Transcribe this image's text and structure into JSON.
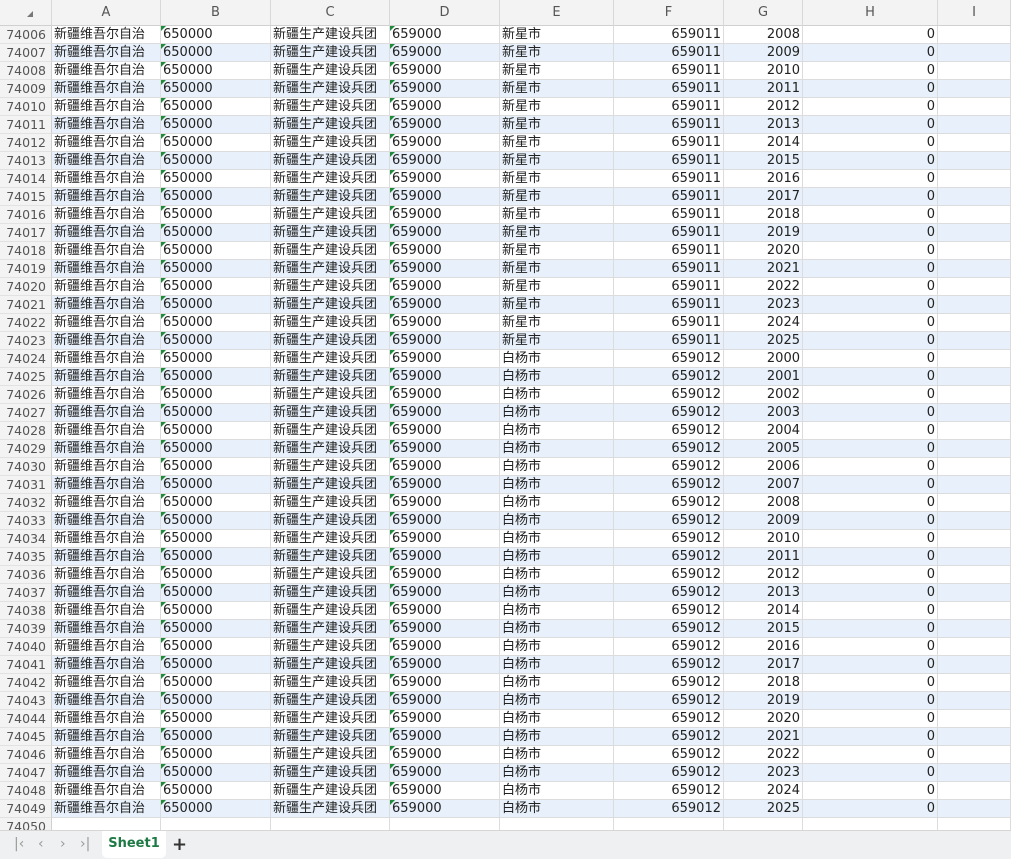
{
  "columns": [
    "A",
    "B",
    "C",
    "D",
    "E",
    "F",
    "G",
    "H",
    "I"
  ],
  "rows": [
    [
      "74006",
      "新疆维吾尔自治",
      "650000",
      "新疆生产建设兵团",
      "659000",
      "新星市",
      "659011",
      "2008",
      "0"
    ],
    [
      "74007",
      "新疆维吾尔自治",
      "650000",
      "新疆生产建设兵团",
      "659000",
      "新星市",
      "659011",
      "2009",
      "0"
    ],
    [
      "74008",
      "新疆维吾尔自治",
      "650000",
      "新疆生产建设兵团",
      "659000",
      "新星市",
      "659011",
      "2010",
      "0"
    ],
    [
      "74009",
      "新疆维吾尔自治",
      "650000",
      "新疆生产建设兵团",
      "659000",
      "新星市",
      "659011",
      "2011",
      "0"
    ],
    [
      "74010",
      "新疆维吾尔自治",
      "650000",
      "新疆生产建设兵团",
      "659000",
      "新星市",
      "659011",
      "2012",
      "0"
    ],
    [
      "74011",
      "新疆维吾尔自治",
      "650000",
      "新疆生产建设兵团",
      "659000",
      "新星市",
      "659011",
      "2013",
      "0"
    ],
    [
      "74012",
      "新疆维吾尔自治",
      "650000",
      "新疆生产建设兵团",
      "659000",
      "新星市",
      "659011",
      "2014",
      "0"
    ],
    [
      "74013",
      "新疆维吾尔自治",
      "650000",
      "新疆生产建设兵团",
      "659000",
      "新星市",
      "659011",
      "2015",
      "0"
    ],
    [
      "74014",
      "新疆维吾尔自治",
      "650000",
      "新疆生产建设兵团",
      "659000",
      "新星市",
      "659011",
      "2016",
      "0"
    ],
    [
      "74015",
      "新疆维吾尔自治",
      "650000",
      "新疆生产建设兵团",
      "659000",
      "新星市",
      "659011",
      "2017",
      "0"
    ],
    [
      "74016",
      "新疆维吾尔自治",
      "650000",
      "新疆生产建设兵团",
      "659000",
      "新星市",
      "659011",
      "2018",
      "0"
    ],
    [
      "74017",
      "新疆维吾尔自治",
      "650000",
      "新疆生产建设兵团",
      "659000",
      "新星市",
      "659011",
      "2019",
      "0"
    ],
    [
      "74018",
      "新疆维吾尔自治",
      "650000",
      "新疆生产建设兵团",
      "659000",
      "新星市",
      "659011",
      "2020",
      "0"
    ],
    [
      "74019",
      "新疆维吾尔自治",
      "650000",
      "新疆生产建设兵团",
      "659000",
      "新星市",
      "659011",
      "2021",
      "0"
    ],
    [
      "74020",
      "新疆维吾尔自治",
      "650000",
      "新疆生产建设兵团",
      "659000",
      "新星市",
      "659011",
      "2022",
      "0"
    ],
    [
      "74021",
      "新疆维吾尔自治",
      "650000",
      "新疆生产建设兵团",
      "659000",
      "新星市",
      "659011",
      "2023",
      "0"
    ],
    [
      "74022",
      "新疆维吾尔自治",
      "650000",
      "新疆生产建设兵团",
      "659000",
      "新星市",
      "659011",
      "2024",
      "0"
    ],
    [
      "74023",
      "新疆维吾尔自治",
      "650000",
      "新疆生产建设兵团",
      "659000",
      "新星市",
      "659011",
      "2025",
      "0"
    ],
    [
      "74024",
      "新疆维吾尔自治",
      "650000",
      "新疆生产建设兵团",
      "659000",
      "白杨市",
      "659012",
      "2000",
      "0"
    ],
    [
      "74025",
      "新疆维吾尔自治",
      "650000",
      "新疆生产建设兵团",
      "659000",
      "白杨市",
      "659012",
      "2001",
      "0"
    ],
    [
      "74026",
      "新疆维吾尔自治",
      "650000",
      "新疆生产建设兵团",
      "659000",
      "白杨市",
      "659012",
      "2002",
      "0"
    ],
    [
      "74027",
      "新疆维吾尔自治",
      "650000",
      "新疆生产建设兵团",
      "659000",
      "白杨市",
      "659012",
      "2003",
      "0"
    ],
    [
      "74028",
      "新疆维吾尔自治",
      "650000",
      "新疆生产建设兵团",
      "659000",
      "白杨市",
      "659012",
      "2004",
      "0"
    ],
    [
      "74029",
      "新疆维吾尔自治",
      "650000",
      "新疆生产建设兵团",
      "659000",
      "白杨市",
      "659012",
      "2005",
      "0"
    ],
    [
      "74030",
      "新疆维吾尔自治",
      "650000",
      "新疆生产建设兵团",
      "659000",
      "白杨市",
      "659012",
      "2006",
      "0"
    ],
    [
      "74031",
      "新疆维吾尔自治",
      "650000",
      "新疆生产建设兵团",
      "659000",
      "白杨市",
      "659012",
      "2007",
      "0"
    ],
    [
      "74032",
      "新疆维吾尔自治",
      "650000",
      "新疆生产建设兵团",
      "659000",
      "白杨市",
      "659012",
      "2008",
      "0"
    ],
    [
      "74033",
      "新疆维吾尔自治",
      "650000",
      "新疆生产建设兵团",
      "659000",
      "白杨市",
      "659012",
      "2009",
      "0"
    ],
    [
      "74034",
      "新疆维吾尔自治",
      "650000",
      "新疆生产建设兵团",
      "659000",
      "白杨市",
      "659012",
      "2010",
      "0"
    ],
    [
      "74035",
      "新疆维吾尔自治",
      "650000",
      "新疆生产建设兵团",
      "659000",
      "白杨市",
      "659012",
      "2011",
      "0"
    ],
    [
      "74036",
      "新疆维吾尔自治",
      "650000",
      "新疆生产建设兵团",
      "659000",
      "白杨市",
      "659012",
      "2012",
      "0"
    ],
    [
      "74037",
      "新疆维吾尔自治",
      "650000",
      "新疆生产建设兵团",
      "659000",
      "白杨市",
      "659012",
      "2013",
      "0"
    ],
    [
      "74038",
      "新疆维吾尔自治",
      "650000",
      "新疆生产建设兵团",
      "659000",
      "白杨市",
      "659012",
      "2014",
      "0"
    ],
    [
      "74039",
      "新疆维吾尔自治",
      "650000",
      "新疆生产建设兵团",
      "659000",
      "白杨市",
      "659012",
      "2015",
      "0"
    ],
    [
      "74040",
      "新疆维吾尔自治",
      "650000",
      "新疆生产建设兵团",
      "659000",
      "白杨市",
      "659012",
      "2016",
      "0"
    ],
    [
      "74041",
      "新疆维吾尔自治",
      "650000",
      "新疆生产建设兵团",
      "659000",
      "白杨市",
      "659012",
      "2017",
      "0"
    ],
    [
      "74042",
      "新疆维吾尔自治",
      "650000",
      "新疆生产建设兵团",
      "659000",
      "白杨市",
      "659012",
      "2018",
      "0"
    ],
    [
      "74043",
      "新疆维吾尔自治",
      "650000",
      "新疆生产建设兵团",
      "659000",
      "白杨市",
      "659012",
      "2019",
      "0"
    ],
    [
      "74044",
      "新疆维吾尔自治",
      "650000",
      "新疆生产建设兵团",
      "659000",
      "白杨市",
      "659012",
      "2020",
      "0"
    ],
    [
      "74045",
      "新疆维吾尔自治",
      "650000",
      "新疆生产建设兵团",
      "659000",
      "白杨市",
      "659012",
      "2021",
      "0"
    ],
    [
      "74046",
      "新疆维吾尔自治",
      "650000",
      "新疆生产建设兵团",
      "659000",
      "白杨市",
      "659012",
      "2022",
      "0"
    ],
    [
      "74047",
      "新疆维吾尔自治",
      "650000",
      "新疆生产建设兵团",
      "659000",
      "白杨市",
      "659012",
      "2023",
      "0"
    ],
    [
      "74048",
      "新疆维吾尔自治",
      "650000",
      "新疆生产建设兵团",
      "659000",
      "白杨市",
      "659012",
      "2024",
      "0"
    ],
    [
      "74049",
      "新疆维吾尔自治",
      "650000",
      "新疆生产建设兵团",
      "659000",
      "白杨市",
      "659012",
      "2025",
      "0"
    ],
    [
      "74050",
      "",
      "",
      "",
      "",
      "",
      "",
      "",
      ""
    ]
  ],
  "tabs": {
    "nav": [
      "first-sheet-icon",
      "prev-sheet-icon",
      "next-sheet-icon",
      "last-sheet-icon"
    ],
    "nav_glyphs": [
      "|‹",
      "‹",
      "›",
      "›|"
    ],
    "active": "Sheet1",
    "add": "+"
  },
  "colors": {
    "alt_row": "#e8f1fb",
    "text_number_marker": "#1e8a3a",
    "active_tab": "#1e7a45"
  }
}
